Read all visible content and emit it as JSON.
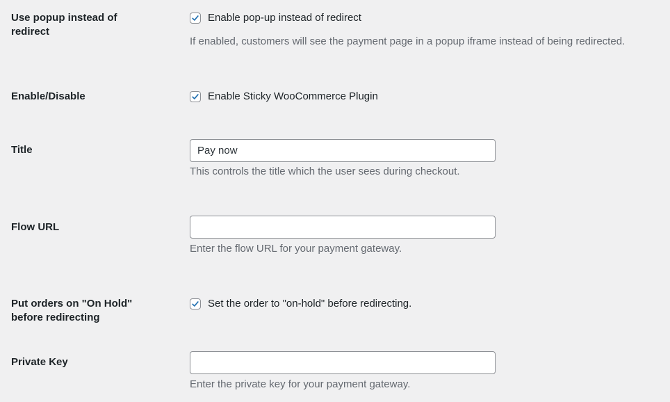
{
  "fields": {
    "popup": {
      "label": "Use popup instead of redirect",
      "checkbox_label": "Enable pop-up instead of redirect",
      "checked": true,
      "description": "If enabled, customers will see the payment page in a popup iframe instead of being redirected."
    },
    "enable": {
      "label": "Enable/Disable",
      "checkbox_label": "Enable Sticky WooCommerce Plugin",
      "checked": true
    },
    "title": {
      "label": "Title",
      "value": "Pay now",
      "description": "This controls the title which the user sees during checkout."
    },
    "flow_url": {
      "label": "Flow URL",
      "value": "",
      "description": "Enter the flow URL for your payment gateway."
    },
    "on_hold": {
      "label": "Put orders on \"On Hold\" before redirecting",
      "checkbox_label": "Set the order to \"on-hold\" before redirecting.",
      "checked": true
    },
    "private_key": {
      "label": "Private Key",
      "value": "",
      "description": "Enter the private key for your payment gateway."
    }
  },
  "icons": {
    "checkmark": "checkmark-icon"
  },
  "colors": {
    "background": "#f0f0f1",
    "checkmark": "#2271b1",
    "label_text": "#1d2327",
    "description_text": "#646970",
    "input_border": "#8c8f94"
  }
}
